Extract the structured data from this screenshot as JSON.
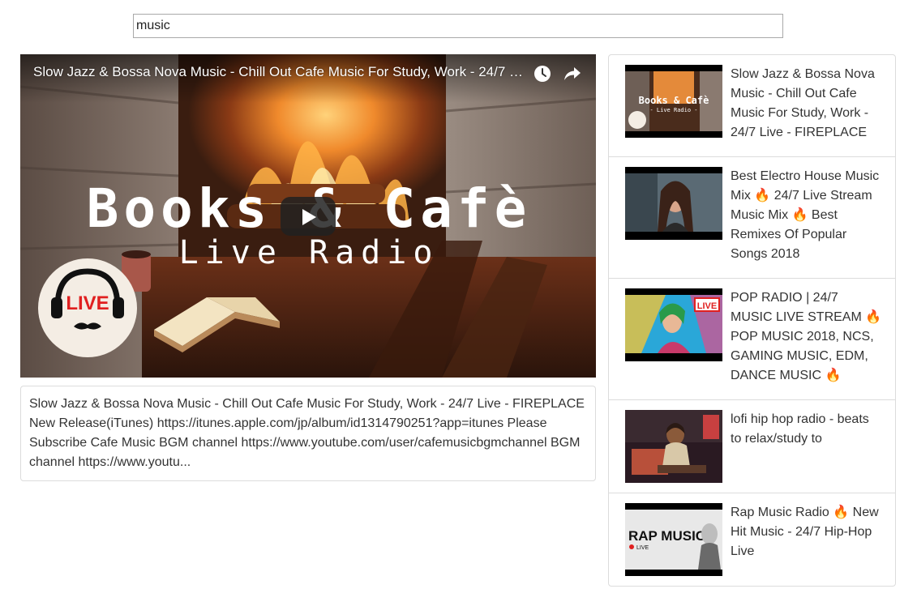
{
  "search": {
    "value": "music"
  },
  "player": {
    "title": "Slow Jazz & Bossa Nova Music - Chill Out Cafe Music For Study, Work - 24/7 Live - FIREPLACE",
    "thumbnail_headline": "Books & Cafè",
    "thumbnail_subline": "Live Radio",
    "badge_text": "LIVE",
    "icons": [
      "watch-later-icon",
      "share-icon",
      "play-icon"
    ]
  },
  "description": {
    "text": "Slow Jazz & Bossa Nova Music - Chill Out Cafe Music For Study, Work - 24/7 Live - FIREPLACE New Release(iTunes) https://itunes.apple.com/jp/album/id1314790251?app=itunes Please Subscribe Cafe Music BGM channel https://www.youtube.com/user/cafemusicbgmchannel BGM channel https://www.youtu..."
  },
  "videos": [
    {
      "title": "Slow Jazz & Bossa Nova Music - Chill Out Cafe Music For Study, Work - 24/7 Live - FIREPLACE",
      "thumb_text": "Books & Cafè",
      "thumb_subtext": "- Live Radio -"
    },
    {
      "title": "Best Electro House Music Mix 🔥 24/7 Live Stream Music Mix 🔥 Best Remixes Of Popular Songs 2018"
    },
    {
      "title": "POP RADIO | 24/7 MUSIC LIVE STREAM 🔥 POP MUSIC 2018, NCS, GAMING MUSIC, EDM, DANCE MUSIC 🔥",
      "thumb_text": "LIVE"
    },
    {
      "title": "lofi hip hop radio - beats to relax/study to"
    },
    {
      "title": "Rap Music Radio 🔥 New Hit Music - 24/7 Hip-Hop Live",
      "thumb_text": "RAP MUSIC",
      "thumb_subtext": "LIVE"
    }
  ]
}
